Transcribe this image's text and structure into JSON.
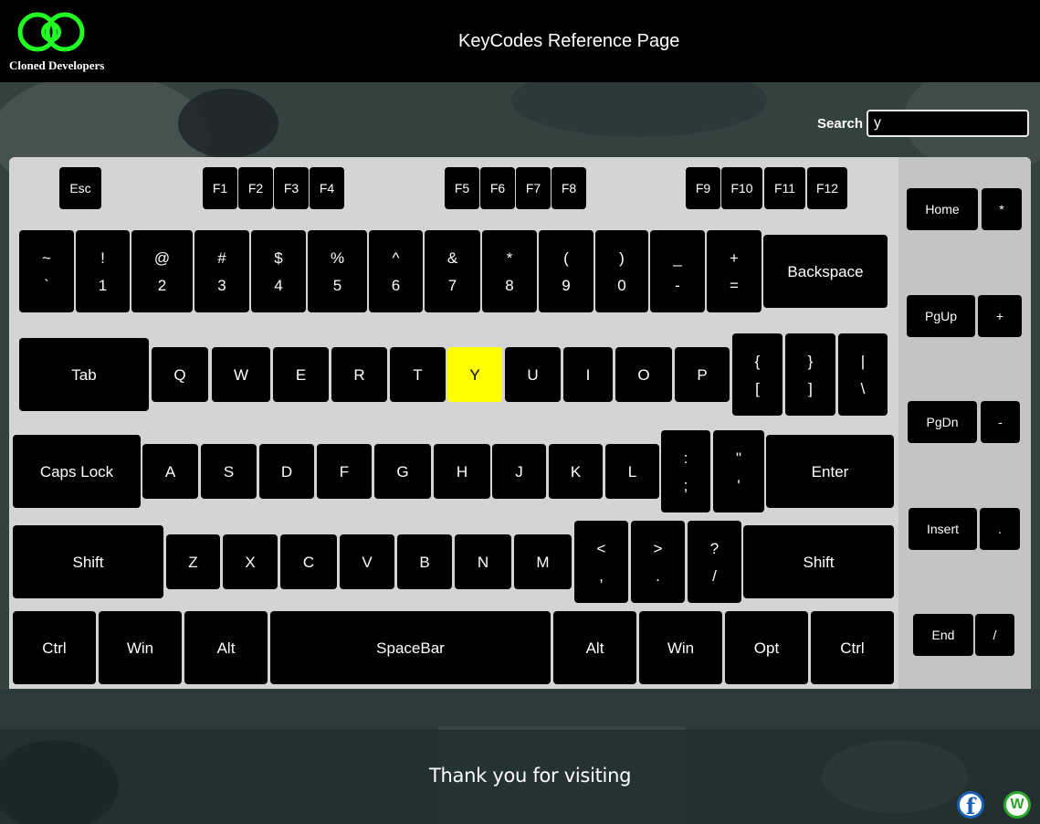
{
  "header": {
    "brand": "Cloned Developers",
    "title": "KeyCodes Reference Page",
    "logo_color": "#22ff22"
  },
  "search": {
    "label": "Search",
    "value": "y"
  },
  "keyboard": {
    "highlight_color": "#ffff00",
    "highlighted_key": "Y",
    "function_row": [
      "Esc",
      "F1",
      "F2",
      "F3",
      "F4",
      "F5",
      "F6",
      "F7",
      "F8",
      "F9",
      "F10",
      "F11",
      "F12"
    ],
    "number_row": [
      {
        "top": "~",
        "bottom": "`"
      },
      {
        "top": "!",
        "bottom": "1"
      },
      {
        "top": "@",
        "bottom": "2"
      },
      {
        "top": "#",
        "bottom": "3"
      },
      {
        "top": "$",
        "bottom": "4"
      },
      {
        "top": "%",
        "bottom": "5"
      },
      {
        "top": "^",
        "bottom": "6"
      },
      {
        "top": "&",
        "bottom": "7"
      },
      {
        "top": "*",
        "bottom": "8"
      },
      {
        "top": "(",
        "bottom": "9"
      },
      {
        "top": ")",
        "bottom": "0"
      },
      {
        "top": "_",
        "bottom": "-"
      },
      {
        "top": "+",
        "bottom": "="
      },
      {
        "label": "Backspace"
      }
    ],
    "top_row": [
      {
        "label": "Tab"
      },
      {
        "label": "Q"
      },
      {
        "label": "W"
      },
      {
        "label": "E"
      },
      {
        "label": "R"
      },
      {
        "label": "T"
      },
      {
        "label": "Y"
      },
      {
        "label": "U"
      },
      {
        "label": "I"
      },
      {
        "label": "O"
      },
      {
        "label": "P"
      },
      {
        "top": "{",
        "bottom": "["
      },
      {
        "top": "}",
        "bottom": "]"
      },
      {
        "top": "|",
        "bottom": "\\"
      }
    ],
    "home_row": [
      {
        "label": "Caps Lock"
      },
      {
        "label": "A"
      },
      {
        "label": "S"
      },
      {
        "label": "D"
      },
      {
        "label": "F"
      },
      {
        "label": "G"
      },
      {
        "label": "H"
      },
      {
        "label": "J"
      },
      {
        "label": "K"
      },
      {
        "label": "L"
      },
      {
        "top": ":",
        "bottom": ";"
      },
      {
        "top": "\"",
        "bottom": "'"
      },
      {
        "label": "Enter"
      }
    ],
    "bottom_row": [
      {
        "label": "Shift"
      },
      {
        "label": "Z"
      },
      {
        "label": "X"
      },
      {
        "label": "C"
      },
      {
        "label": "V"
      },
      {
        "label": "B"
      },
      {
        "label": "N"
      },
      {
        "label": "M"
      },
      {
        "top": "<",
        "bottom": ","
      },
      {
        "top": ">",
        "bottom": "."
      },
      {
        "top": "?",
        "bottom": "/"
      },
      {
        "label": "Shift"
      }
    ],
    "space_row": [
      "Ctrl",
      "Win",
      "Alt",
      "SpaceBar",
      "Alt",
      "Win",
      "Opt",
      "Ctrl"
    ],
    "side_keys": [
      "Home",
      "*",
      "PgUp",
      "+",
      "PgDn",
      "-",
      "Insert",
      ".",
      "End",
      "/"
    ]
  },
  "footer": {
    "text": "Thank you for visiting",
    "icons": [
      "facebook-icon",
      "w-icon"
    ]
  }
}
